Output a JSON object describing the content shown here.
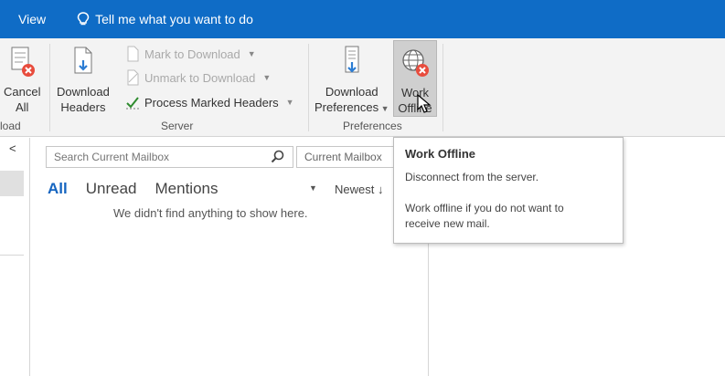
{
  "titlebar": {
    "menu_view": "View",
    "tell_me": "Tell me what you want to do",
    "color": "#0f6cc6"
  },
  "ribbon": {
    "cancel_all": {
      "line1": "Cancel",
      "line2": "All",
      "group_label": "load"
    },
    "download_headers": {
      "line1": "Download",
      "line2": "Headers"
    },
    "mark_to_download": "Mark to Download",
    "unmark_to_download": "Unmark to Download",
    "process_marked_headers": "Process Marked Headers",
    "server_group_label": "Server",
    "download_preferences": {
      "line1": "Download",
      "line2": "Preferences"
    },
    "work_offline": {
      "line1": "Work",
      "line2": "Offline"
    },
    "preferences_group_label": "Preferences"
  },
  "rail": {
    "collapse_glyph": "<"
  },
  "search": {
    "placeholder": "Search Current Mailbox",
    "scope": "Current Mailbox"
  },
  "filters": {
    "all": "All",
    "unread": "Unread",
    "mentions": "Mentions"
  },
  "sort": {
    "label": "Newest",
    "arrow": "↓"
  },
  "empty_message": "We didn't find anything to show here.",
  "tooltip": {
    "title": "Work Offline",
    "line1": "Disconnect from the server.",
    "line2": "Work offline if you do not want to",
    "line3": "receive new mail."
  },
  "colors": {
    "accent": "#1565c0",
    "error_badge": "#e84c3d"
  },
  "icons": [
    "lightbulb-icon",
    "cancel-all-icon",
    "download-headers-icon",
    "mark-download-icon",
    "unmark-download-icon",
    "checkmark-icon",
    "download-preferences-icon",
    "globe-offline-icon",
    "search-icon"
  ]
}
